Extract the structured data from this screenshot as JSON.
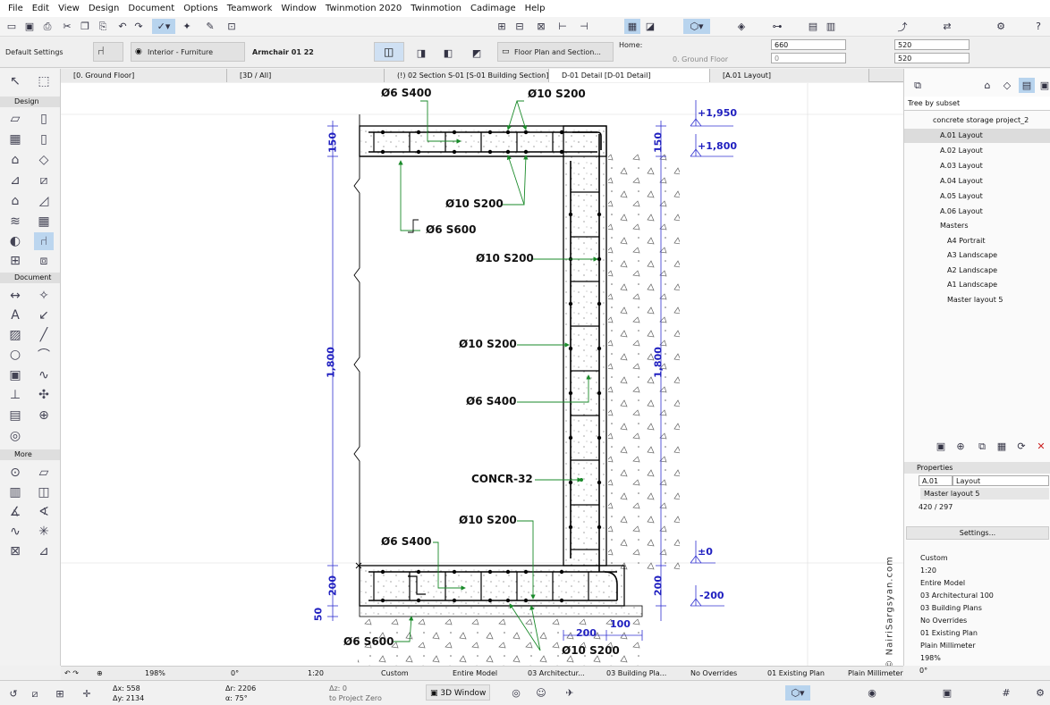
{
  "menu": [
    "File",
    "Edit",
    "View",
    "Design",
    "Document",
    "Options",
    "Teamwork",
    "Window",
    "Twinmotion 2020",
    "Twinmotion",
    "Cadimage",
    "Help"
  ],
  "infobox": {
    "settings_label": "Default Settings",
    "layer": "Interior - Furniture",
    "object_name": "Armchair 01 22",
    "floor_plan_section": "Floor Plan and Section...",
    "home_label": "Home:",
    "home_story": "0. Ground Floor",
    "height_value": "660",
    "offset_value": "0",
    "width_value": "520",
    "depth_value": "520"
  },
  "tabs": [
    {
      "label": "[0. Ground Floor]"
    },
    {
      "label": "[3D / All]"
    },
    {
      "label": "(!) 02 Section S-01 [S-01 Building Section]"
    },
    {
      "label": "D-01 Detail [D-01 Detail]"
    },
    {
      "label": "[A.01 Layout]"
    }
  ],
  "toolbox": {
    "design": "Design",
    "document": "Document",
    "more": "More"
  },
  "drawing": {
    "labels": {
      "l1": "Ø6 S400",
      "l2": "Ø10 S200",
      "l3": "Ø10 S200",
      "l4": "Ø6 S600",
      "l5": "Ø10 S200",
      "l6": "Ø10 S200",
      "l7": "Ø6 S400",
      "l8": "CONCR-32",
      "l9": "Ø10 S200",
      "l10": "Ø6 S400",
      "l11": "Ø6 S600",
      "l12": "Ø10 S200"
    },
    "levels": {
      "a": "+1,950",
      "b": "+1,800",
      "c": "±0",
      "d": "-200"
    },
    "dims": {
      "d150a": "150",
      "d1800a": "1,800",
      "d200a": "200",
      "d50": "50",
      "d150b": "150",
      "d1800b": "1,800",
      "d200b": "200",
      "d200h": "200",
      "d100h": "100"
    },
    "signature": "© NairiSargsyan.com"
  },
  "navigator": {
    "tree_mode": "Tree by subset",
    "project": "concrete storage project_2",
    "layouts": [
      "A.01 Layout",
      "A.02 Layout",
      "A.03 Layout",
      "A.04 Layout",
      "A.05 Layout",
      "A.06 Layout"
    ],
    "masters_label": "Masters",
    "masters": [
      "A4 Portrait",
      "A3 Landscape",
      "A2 Landscape",
      "A1 Landscape",
      "Master layout 5"
    ]
  },
  "properties": {
    "header": "Properties",
    "id": "A.01",
    "name": "Layout",
    "master": "Master layout 5",
    "size": "420 / 297",
    "settings_btn": "Settings...",
    "rows": [
      "Custom",
      "1:20",
      "Entire Model",
      "03 Architectural 100",
      "03 Building Plans",
      "No Overrides",
      "01 Existing Plan",
      "Plain Millimeter",
      "198%",
      "0°"
    ]
  },
  "bottombar": {
    "zoom": "198%",
    "angle": "0°",
    "scale": "1:20",
    "custom": "Custom",
    "model": "Entire Model",
    "layer_combo": "03 Architectur...",
    "view": "03 Building Pla...",
    "overrides": "No Overrides",
    "renovation": "01 Existing Plan",
    "dimension": "Plain Millimeter"
  },
  "status": {
    "dx": "Δx: 558",
    "dy": "Δy: 2134",
    "dr": "Δr: 2206",
    "da": "α: 75°",
    "dz": "Δz: 0",
    "ref": "to Project Zero",
    "window3d": "3D Window"
  }
}
